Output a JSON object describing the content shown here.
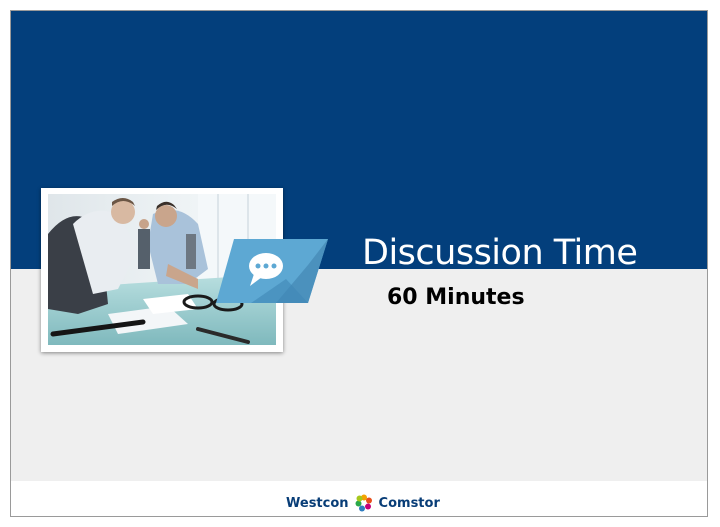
{
  "slide": {
    "title": "Discussion Time",
    "subtitle": "60 Minutes"
  },
  "logo": {
    "left_word": "Westcon",
    "right_word": "Comstor",
    "icon": "multicolor-flower-icon"
  },
  "colors": {
    "header_blue": "#033f7c",
    "body_gray": "#efefef",
    "badge_blue": "#5da8d3",
    "logo_text": "#083d77"
  },
  "photo": {
    "description_icon": "business-meeting-photo"
  }
}
